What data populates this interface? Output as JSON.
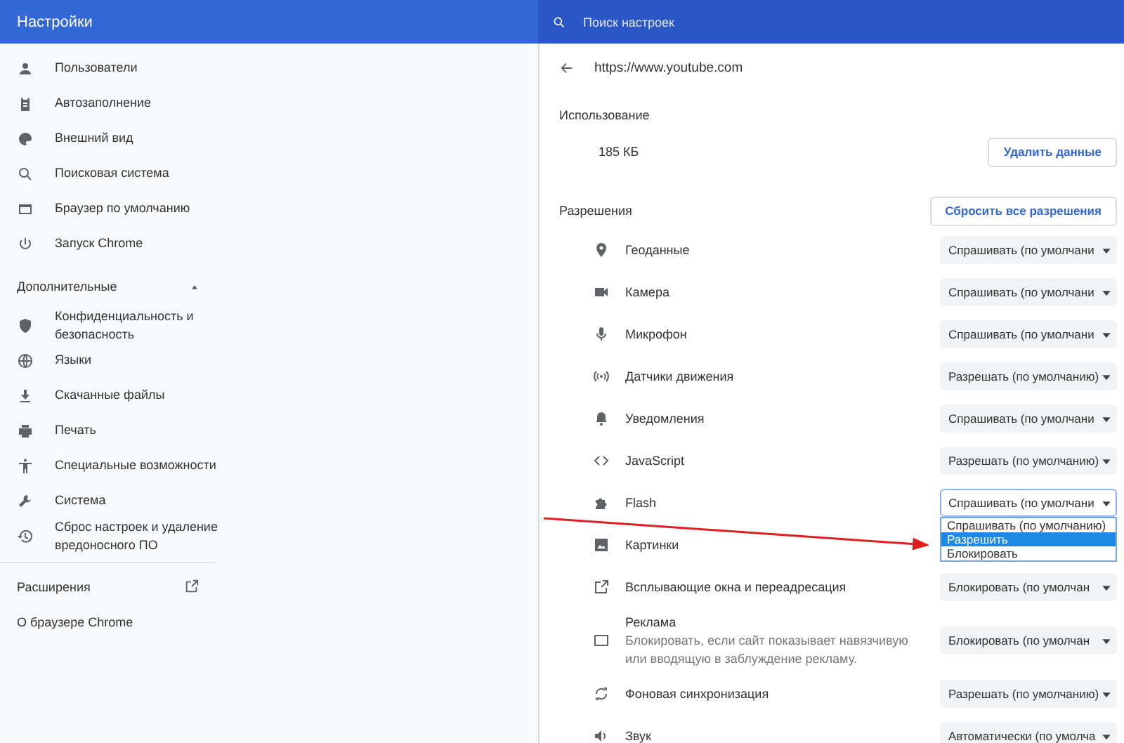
{
  "header": {
    "title": "Настройки",
    "search": {
      "placeholder": "Поиск настроек"
    }
  },
  "sidebar": {
    "items": [
      {
        "label": "Пользователи"
      },
      {
        "label": "Автозаполнение"
      },
      {
        "label": "Внешний вид"
      },
      {
        "label": "Поисковая система"
      },
      {
        "label": "Браузер по умолчанию"
      },
      {
        "label": "Запуск Chrome"
      }
    ],
    "advanced": {
      "label": "Дополнительные",
      "expanded": true,
      "items": [
        {
          "label": "Конфиденциальность и безопасность"
        },
        {
          "label": "Языки"
        },
        {
          "label": "Скачанные файлы"
        },
        {
          "label": "Печать"
        },
        {
          "label": "Специальные возможности"
        },
        {
          "label": "Система"
        },
        {
          "label": "Сброс настроек и удаление вредоносного ПО"
        }
      ]
    },
    "extensions": "Расширения",
    "about": "О браузере Chrome"
  },
  "site": {
    "url": "https://www.youtube.com",
    "usage_heading": "Использование",
    "usage": "185 КБ",
    "clear_button": "Удалить данные",
    "permissions_heading": "Разрешения",
    "reset_button": "Сбросить все разрешения",
    "permissions": [
      {
        "name": "Геоданные",
        "value": "Спрашивать (по умолчани"
      },
      {
        "name": "Камера",
        "value": "Спрашивать (по умолчани"
      },
      {
        "name": "Микрофон",
        "value": "Спрашивать (по умолчани"
      },
      {
        "name": "Датчики движения",
        "value": "Разрешать (по умолчанию)"
      },
      {
        "name": "Уведомления",
        "value": "Спрашивать (по умолчани"
      },
      {
        "name": "JavaScript",
        "value": "Разрешать (по умолчанию)"
      },
      {
        "name": "Flash",
        "value": "Спрашивать (по умолчани",
        "options": [
          {
            "label": "Спрашивать (по умолчанию)",
            "selected": false
          },
          {
            "label": "Разрешить",
            "selected": true
          },
          {
            "label": "Блокировать",
            "selected": false
          }
        ]
      },
      {
        "name": "Картинки"
      },
      {
        "name": "Всплывающие окна и переадресация",
        "value": "Блокировать (по умолчан"
      },
      {
        "name": "Реклама",
        "description": "Блокировать, если сайт показывает навязчивую или вводящую в заблуждение рекламу.",
        "value": "Блокировать (по умолчан"
      },
      {
        "name": "Фоновая синхронизация",
        "value": "Разрешать (по умолчанию)"
      },
      {
        "name": "Звук",
        "value": "Автоматически (по умолча"
      }
    ]
  }
}
